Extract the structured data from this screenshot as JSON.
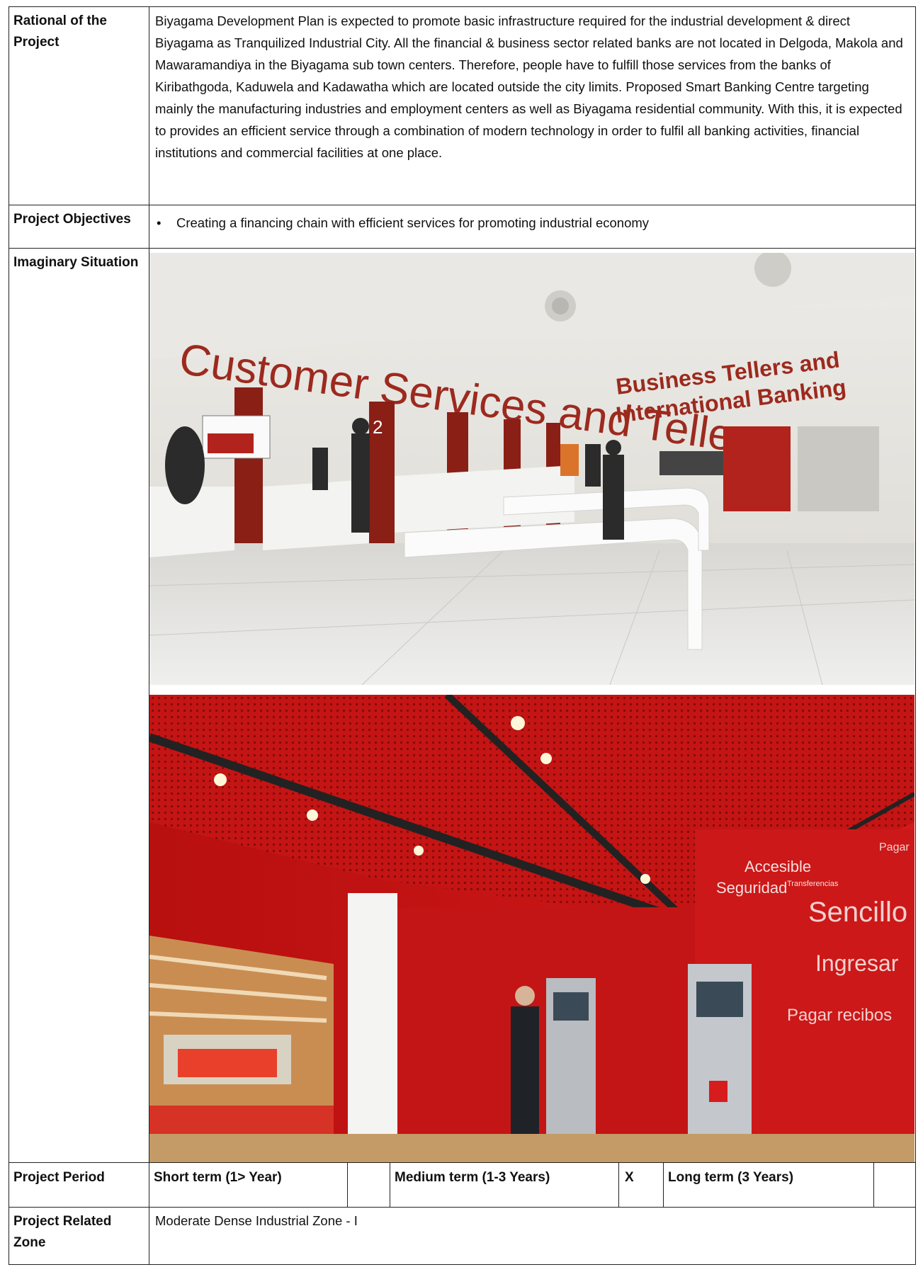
{
  "rows": {
    "rationale": {
      "label": "Rational of the Project",
      "text": "Biyagama Development Plan is expected to promote basic infrastructure required for the industrial development & direct Biyagama as Tranquilized Industrial City. All the financial & business sector related banks are not located in Delgoda, Makola and Mawaramandiya in the Biyagama sub town centers. Therefore, people have to fulfill those services from the banks of Kiribathgoda, Kaduwela and Kadawatha which are located outside the city limits. Proposed Smart Banking Centre targeting mainly the manufacturing industries and employment centers as well as Biyagama residential community.  With this, it is expected to provides an efficient service through a combination of modern technology in order to fulfil all banking activities, financial institutions and commercial facilities at one place."
    },
    "objectives": {
      "label": "Project Objectives",
      "items": [
        "Creating a financing chain with efficient services for promoting industrial economy"
      ]
    },
    "imaginary": {
      "label": "Imaginary Situation",
      "photo1": {
        "sign_left": "Customer Services and Tellers",
        "sign_right_1": "Business Tellers and",
        "sign_right_2": "International Banking",
        "counter_number": "2"
      },
      "photo2": {
        "words": [
          "Accesible",
          "Seguridad",
          "Transferencias",
          "Sencillo",
          "Ingresar",
          "Pagar recibos",
          "Pagar"
        ]
      }
    },
    "period": {
      "label": "Project Period",
      "short": "Short term (1> Year)",
      "short_mark": "",
      "medium": "Medium term (1-3 Years)",
      "medium_mark": "X",
      "long": "Long term (3 Years)",
      "long_mark": ""
    },
    "zone": {
      "label": "Project Related Zone",
      "value": "Moderate Dense Industrial Zone - I"
    }
  },
  "colors": {
    "bank_red": "#b3231d",
    "ceiling_red": "#c41414"
  }
}
